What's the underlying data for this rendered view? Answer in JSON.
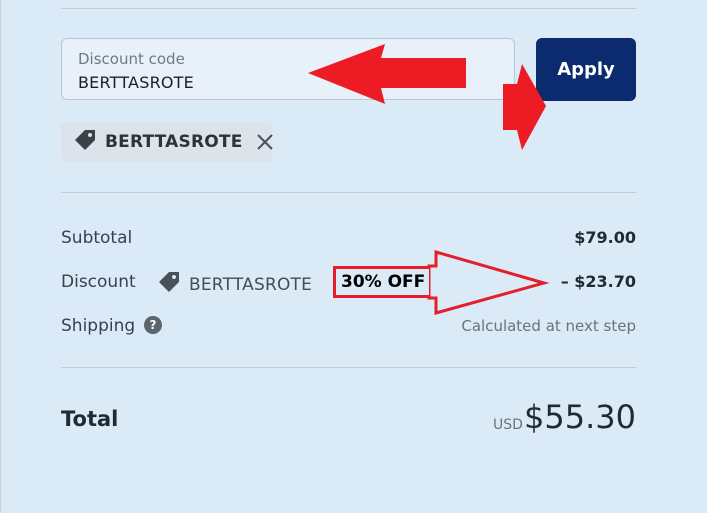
{
  "discount_field": {
    "label": "Discount code",
    "value": "BERTTASROTE"
  },
  "apply_button": {
    "label": "Apply"
  },
  "applied_code_chip": {
    "code": "BERTTASROTE"
  },
  "summary": {
    "subtotal": {
      "label": "Subtotal",
      "value": "$79.00"
    },
    "discount": {
      "label": "Discount",
      "code": "BERTTASROTE",
      "value": "– $23.70"
    },
    "shipping": {
      "label": "Shipping",
      "value": "Calculated at next step"
    }
  },
  "total": {
    "label": "Total",
    "currency": "USD",
    "amount": "$55.30"
  },
  "annotation": {
    "text": "30% OFF"
  },
  "colors": {
    "background": "#dbeaf7",
    "button": "#0b2b6e",
    "arrow": "#e41e2a"
  },
  "icons": {
    "tag": "tag-icon",
    "close": "close-icon",
    "help": "question-mark-icon",
    "arrow": "red-arrow-icon"
  }
}
